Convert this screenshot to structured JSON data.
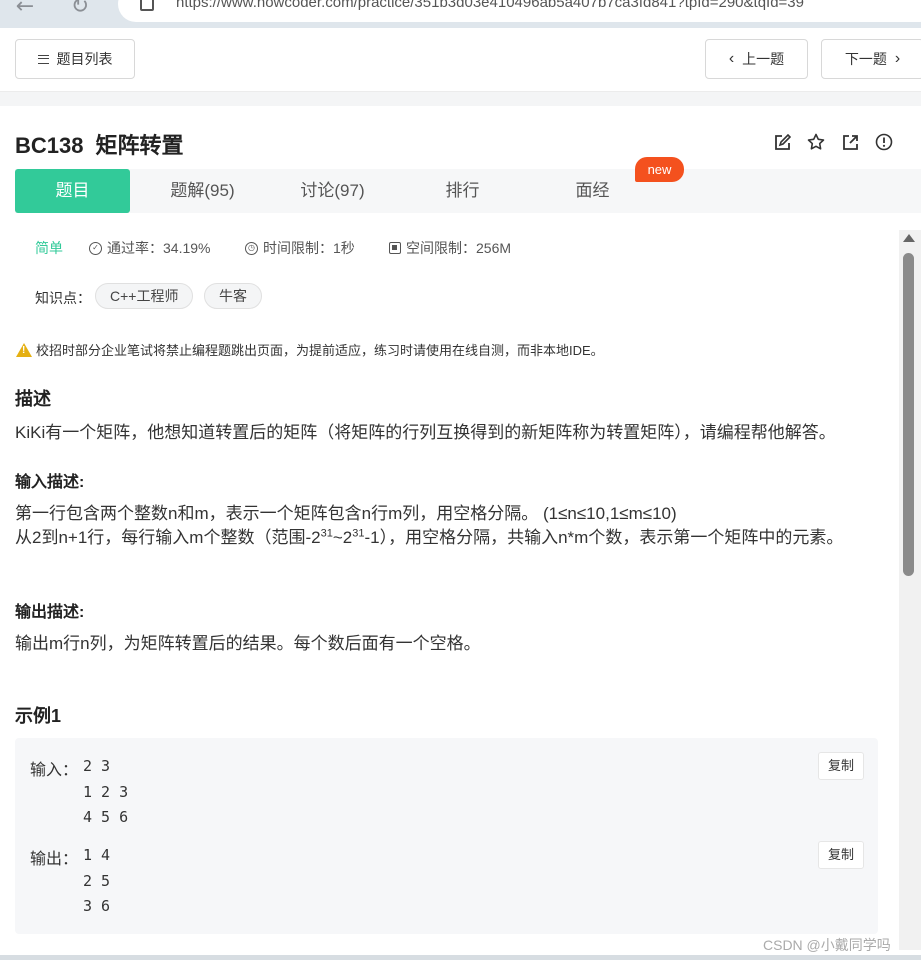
{
  "browser": {
    "url": "https://www.nowcoder.com/practice/351b3d03e410496ab5a407b7ca3fd841?tpId=290&tqId=39"
  },
  "toolbar": {
    "list_label": "题目列表",
    "prev_label": "上一题",
    "next_label": "下一题"
  },
  "problem": {
    "id": "BC138",
    "title": "矩阵转置"
  },
  "tabs": [
    {
      "label": "题目",
      "active": true
    },
    {
      "label": "题解(95)",
      "active": false
    },
    {
      "label": "讨论(97)",
      "active": false
    },
    {
      "label": "排行",
      "active": false
    },
    {
      "label": "面经",
      "active": false,
      "badge": "new"
    }
  ],
  "info": {
    "difficulty": "简单",
    "pass_rate": "通过率：34.19%",
    "time_limit": "时间限制：1秒",
    "space_limit": "空间限制：256M"
  },
  "knowledge": {
    "label": "知识点：",
    "tags": [
      "C++工程师",
      "牛客"
    ]
  },
  "notice": "校招时部分企业笔试将禁止编程题跳出页面，为提前适应，练习时请使用在线自测，而非本地IDE。",
  "description": {
    "heading": "描述",
    "text": "KiKi有一个矩阵，他想知道转置后的矩阵（将矩阵的行列互换得到的新矩阵称为转置矩阵），请编程帮他解答。"
  },
  "input_desc": {
    "heading": "输入描述:",
    "line1": "第一行包含两个整数n和m，表示一个矩阵包含n行m列，用空格分隔。 (1≤n≤10,1≤m≤10)",
    "line2_a": "从2到n+1行，每行输入m个整数（范围-2",
    "line2_sup1": "31",
    "line2_b": "~2",
    "line2_sup2": "31",
    "line2_c": "-1），用空格分隔，共输入n*m个数，表示第一个矩阵中的元素。"
  },
  "output_desc": {
    "heading": "输出描述:",
    "text": "输出m行n列，为矩阵转置后的结果。每个数后面有一个空格。"
  },
  "example": {
    "heading": "示例1",
    "input_label": "输入：",
    "input_lines": "2 3\n1 2 3\n4 5 6",
    "output_label": "输出：",
    "output_lines": "1 4\n2 5\n3 6",
    "copy_label": "复制"
  },
  "watermark": "CSDN @小戴同学吗"
}
